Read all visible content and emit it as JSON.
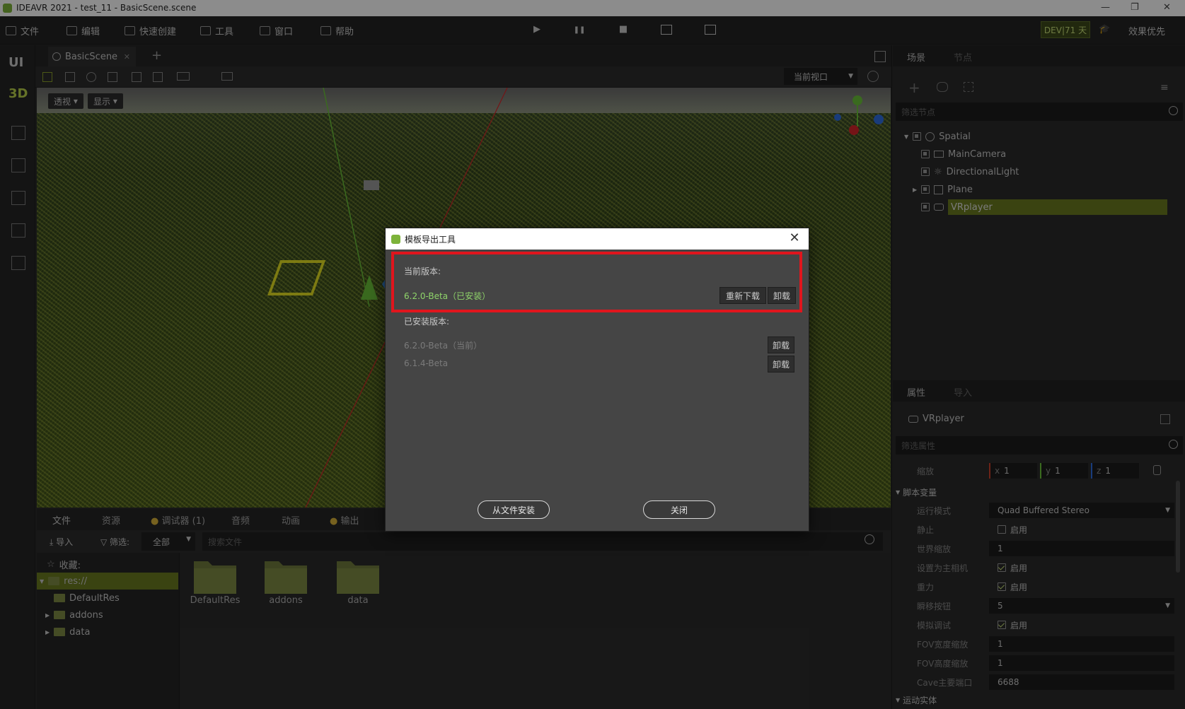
{
  "window": {
    "title": "IDEAVR 2021 - test_11 - BasicScene.scene",
    "minimize": "—",
    "restore": "❐",
    "close": "✕"
  },
  "menu": [
    {
      "label": "文件",
      "icon": "folder-icon"
    },
    {
      "label": "编辑",
      "icon": "crop-icon"
    },
    {
      "label": "快速创建",
      "icon": "edit-icon"
    },
    {
      "label": "工具",
      "icon": "window-icon"
    },
    {
      "label": "窗口",
      "icon": "frame-icon"
    },
    {
      "label": "帮助",
      "icon": "book-icon"
    }
  ],
  "toolbar": {
    "play": "▶",
    "pause": "❚❚",
    "stop": "■",
    "badge": "DEV|71 天",
    "quality": "效果优先"
  },
  "left_toolbar": {
    "ui": "UI",
    "mode3d": "3D"
  },
  "scene_tab": {
    "label": "BasicScene",
    "close": "✕",
    "add": "+"
  },
  "viewport": {
    "current_view": "当前视口",
    "perspective": "透视",
    "display": "显示"
  },
  "bottom": {
    "tabs": [
      "文件",
      "资源",
      "调试器 (1)",
      "音频",
      "动画",
      "输出"
    ],
    "import": "导入",
    "filter": "筛选:",
    "filter_value": "全部",
    "search_placeholder": "搜索文件",
    "favorites": "收藏:",
    "tree": [
      "res://",
      "DefaultRes",
      "addons",
      "data"
    ],
    "files": [
      "DefaultRes",
      "addons",
      "data"
    ]
  },
  "scene_panel": {
    "tab_scene": "场景",
    "tab_node": "节点",
    "filter_placeholder": "筛选节点",
    "nodes": [
      "Spatial",
      "MainCamera",
      "DirectionalLight",
      "Plane",
      "VRplayer"
    ]
  },
  "inspector": {
    "tab_props": "属性",
    "tab_import": "导入",
    "node_name": "VRplayer",
    "filter_placeholder": "筛选属性",
    "scale_label": "缩放",
    "scale": {
      "x": "1",
      "y": "1",
      "z": "1"
    },
    "section_script": "脚本变量",
    "section_motion": "运动实体",
    "props": [
      {
        "label": "运行模式",
        "value": "Quad Buffered Stereo"
      },
      {
        "label": "静止",
        "value": "启用",
        "checked": false
      },
      {
        "label": "世界缩放",
        "value": "1"
      },
      {
        "label": "设置为主相机",
        "value": "启用",
        "checked": true
      },
      {
        "label": "重力",
        "value": "启用",
        "checked": true
      },
      {
        "label": "瞬移按钮",
        "value": "5"
      },
      {
        "label": "模拟调试",
        "value": "启用",
        "checked": true
      },
      {
        "label": "FOV宽度缩放",
        "value": "1"
      },
      {
        "label": "FOV高度缩放",
        "value": "1"
      },
      {
        "label": "Cave主要端口",
        "value": "6688"
      }
    ]
  },
  "dialog": {
    "title": "模板导出工具",
    "close": "✕",
    "current_label": "当前版本:",
    "current_version": "6.2.0-Beta（已安装）",
    "redownload": "重新下载",
    "uninstall": "卸载",
    "installed_label": "已安装版本:",
    "installed": [
      {
        "version": "6.2.0-Beta（当前）",
        "action": "卸载"
      },
      {
        "version": "6.1.4-Beta",
        "action": "卸载"
      }
    ],
    "install_from_file": "从文件安装",
    "close_btn": "关闭"
  },
  "colors": {
    "accent": "#c8e078",
    "highlight_row": "#6b7a1f",
    "red_box": "#e0151d",
    "version_green": "#8fd46a"
  }
}
